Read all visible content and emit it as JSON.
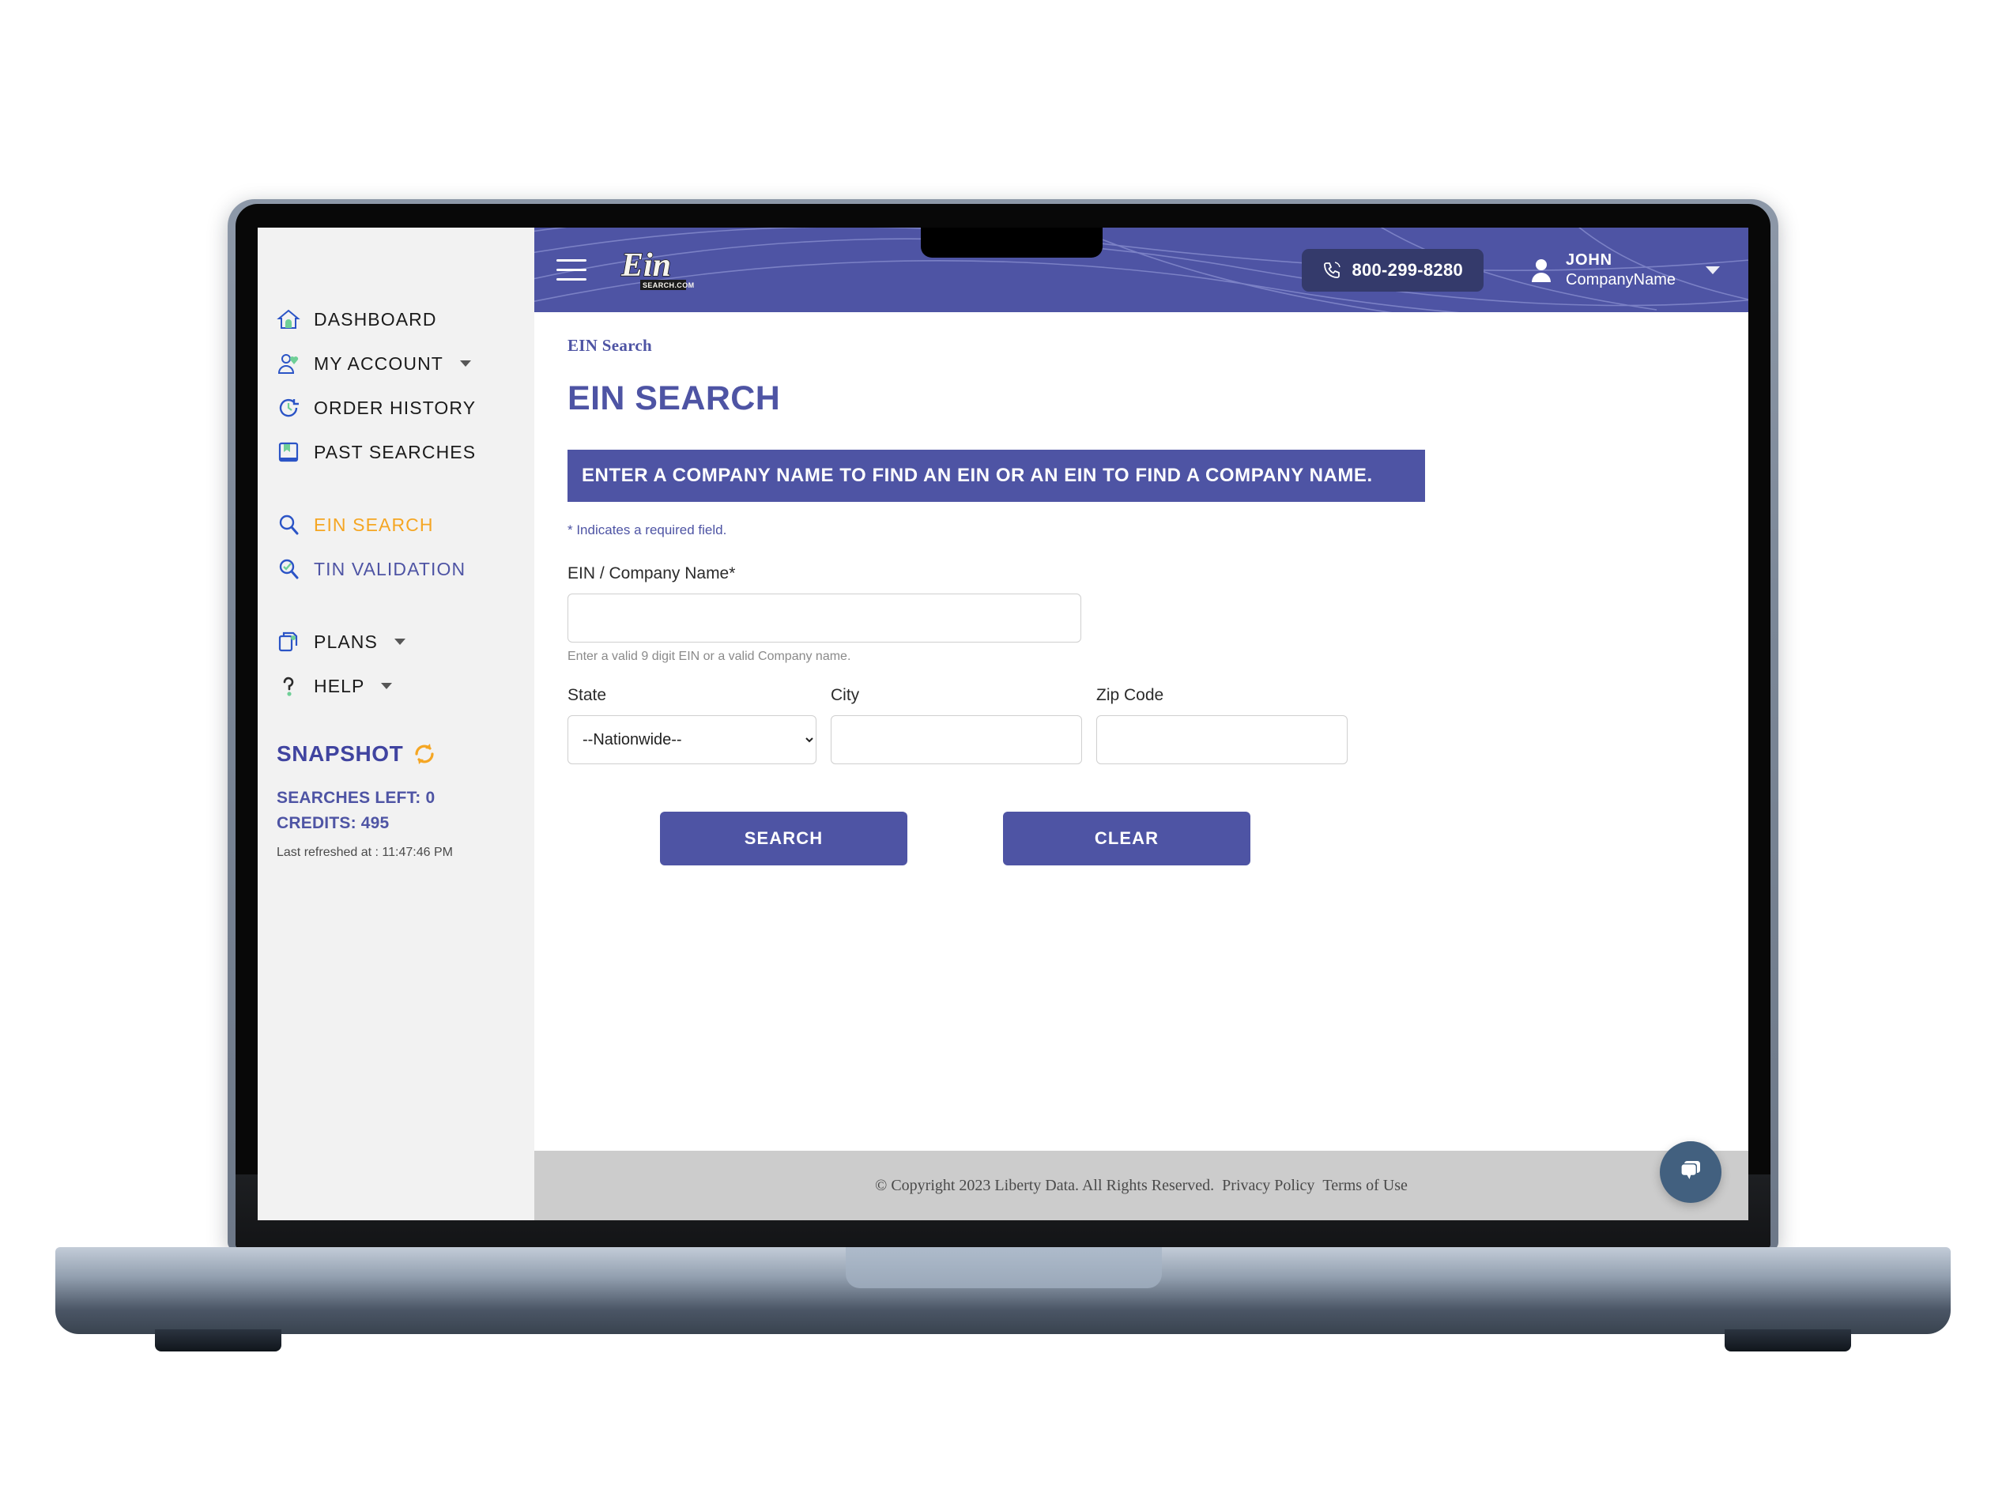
{
  "sidebar": {
    "items": [
      {
        "label": "DASHBOARD",
        "icon": "home-icon",
        "caret": false,
        "state": "normal"
      },
      {
        "label": "MY ACCOUNT",
        "icon": "user-account-icon",
        "caret": true,
        "state": "normal"
      },
      {
        "label": "ORDER HISTORY",
        "icon": "history-clock-icon",
        "caret": false,
        "state": "normal"
      },
      {
        "label": "PAST SEARCHES",
        "icon": "book-icon",
        "caret": false,
        "state": "normal"
      },
      {
        "label": "EIN SEARCH",
        "icon": "magnifier-icon",
        "caret": false,
        "state": "active"
      },
      {
        "label": "TIN VALIDATION",
        "icon": "magnifier-check-icon",
        "caret": false,
        "state": "link"
      },
      {
        "label": "PLANS",
        "icon": "documents-icon",
        "caret": true,
        "state": "normal"
      },
      {
        "label": "HELP",
        "icon": "question-mark-icon",
        "caret": true,
        "state": "normal"
      }
    ],
    "snapshot": {
      "title": "SNAPSHOT",
      "refresh_icon": "refresh-icon",
      "searches_left": "SEARCHES LEFT: 0",
      "credits": "CREDITS: 495",
      "last_refreshed": "Last refreshed at : 11:47:46 PM"
    }
  },
  "topbar": {
    "menu_icon": "hamburger-menu-icon",
    "logo_text": "Ein",
    "logo_sub": "SEARCH.COM",
    "phone_icon": "phone-icon",
    "phone": "800-299-8280",
    "user_icon": "person-icon",
    "user_name": "JOHN",
    "user_company": "CompanyName",
    "user_caret_icon": "chevron-down-icon"
  },
  "main": {
    "breadcrumb": "EIN Search",
    "title": "EIN SEARCH",
    "banner": "ENTER A COMPANY NAME TO FIND AN EIN OR AN EIN TO FIND A COMPANY NAME.",
    "required_note": "* Indicates a required field.",
    "fields": {
      "ein_company": {
        "label": "EIN / Company Name*",
        "value": "",
        "placeholder": "",
        "hint": "Enter a valid 9 digit EIN or a valid Company name."
      },
      "state": {
        "label": "State",
        "selected": "--Nationwide--",
        "options": [
          "--Nationwide--"
        ]
      },
      "city": {
        "label": "City",
        "value": "",
        "placeholder": ""
      },
      "zip": {
        "label": "Zip Code",
        "value": "",
        "placeholder": ""
      }
    },
    "buttons": {
      "search": "SEARCH",
      "clear": "CLEAR"
    }
  },
  "footer": {
    "copyright": "© Copyright 2023 Liberty Data. All Rights Reserved.",
    "privacy": "Privacy Policy",
    "terms": "Terms of Use"
  },
  "chat": {
    "icon": "chat-bubble-icon"
  },
  "colors": {
    "brand_indigo": "#4e54a4",
    "accent_orange": "#f5a623",
    "sidebar_bg": "#f2f2f2",
    "footer_bg": "#cccccc",
    "chat_blue": "#42607f",
    "phone_pill": "#343a6b"
  }
}
